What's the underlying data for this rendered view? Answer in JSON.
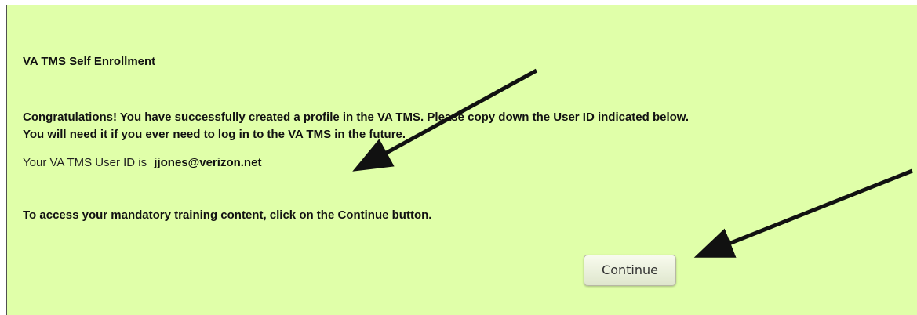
{
  "page": {
    "background_color": "#e0ffa9",
    "heading": "VA TMS Self Enrollment",
    "message_line_1": "Congratulations! You have successfully created a profile in the VA TMS. Please copy down the User ID indicated below.",
    "message_line_2": "You will need it if you ever need to log in to the VA TMS in the future.",
    "user_id_label": "Your VA TMS User ID is",
    "user_id_value": "jjones@verizon.net",
    "instruction": "To access your mandatory training content, click on the Continue button.",
    "continue_label": "Continue"
  },
  "annotations": {
    "arrow_color": "#111111",
    "arrow_targets": [
      "user-id-value",
      "continue-button"
    ]
  }
}
